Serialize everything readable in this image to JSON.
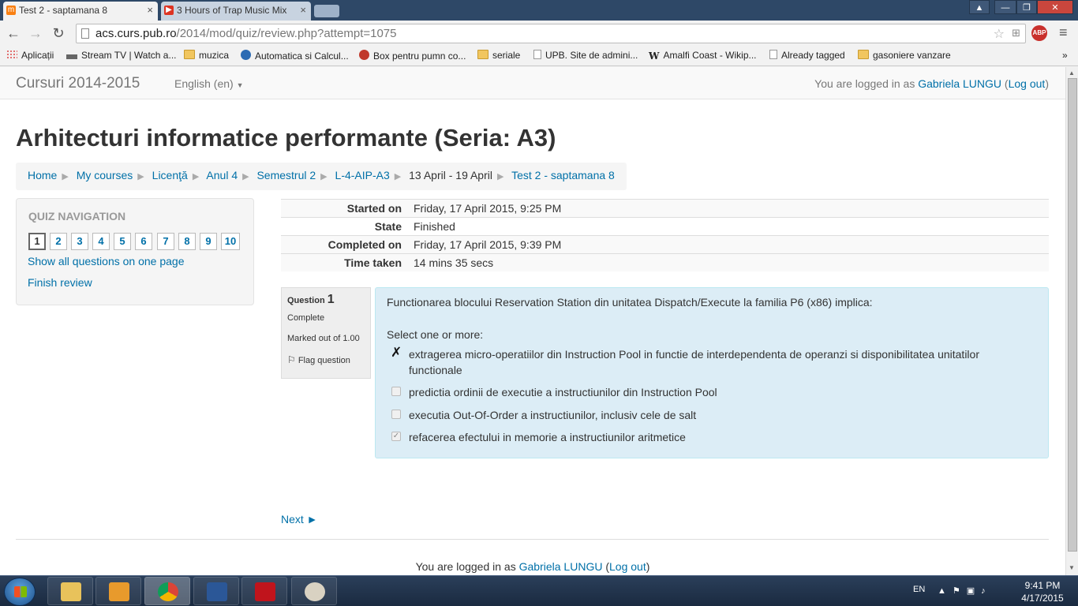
{
  "browser": {
    "tabs": [
      {
        "title": "Test 2 - saptamana 8",
        "active": true
      },
      {
        "title": "3 Hours of Trap Music Mix",
        "active": false
      }
    ],
    "tab_close": "×",
    "url_host": "acs.curs.pub.ro",
    "url_path": "/2014/mod/quiz/review.php?attempt=1075",
    "abp_label": "ABP",
    "bookmarks": [
      {
        "label": "Aplicații",
        "icon": "apps-grid-icon"
      },
      {
        "label": "Stream TV | Watch a...",
        "icon": "tv-icon"
      },
      {
        "label": "muzica",
        "icon": "folder-icon"
      },
      {
        "label": "Automatica si Calcul...",
        "icon": "site-icon"
      },
      {
        "label": "Box pentru pumn co...",
        "icon": "gear-icon"
      },
      {
        "label": "seriale",
        "icon": "folder-icon"
      },
      {
        "label": "UPB. Site de admini...",
        "icon": "page-icon"
      },
      {
        "label": "Amalfi Coast - Wikip...",
        "icon": "wikipedia-icon"
      },
      {
        "label": "Already tagged",
        "icon": "page-icon"
      },
      {
        "label": "gasoniere vanzare",
        "icon": "folder-icon"
      }
    ],
    "bookmarks_overflow": "»"
  },
  "site": {
    "brand": "Cursuri 2014-2015",
    "language": "English (en)",
    "login_prefix": "You are logged in as",
    "user": "Gabriela LUNGU",
    "logout": "Log out"
  },
  "course_title": "Arhitecturi informatice performante (Seria: A3)",
  "breadcrumb": [
    {
      "label": "Home",
      "link": true
    },
    {
      "label": "My courses",
      "link": true
    },
    {
      "label": "Licenţă",
      "link": true
    },
    {
      "label": "Anul 4",
      "link": true
    },
    {
      "label": "Semestrul 2",
      "link": true
    },
    {
      "label": "L-4-AIP-A3",
      "link": true
    },
    {
      "label": "13 April - 19 April",
      "link": false
    },
    {
      "label": "Test 2 - saptamana 8",
      "link": true
    }
  ],
  "quiz_nav": {
    "title": "QUIZ NAVIGATION",
    "buttons": [
      "1",
      "2",
      "3",
      "4",
      "5",
      "6",
      "7",
      "8",
      "9",
      "10"
    ],
    "current": "1",
    "show_all": "Show all questions on one page",
    "finish": "Finish review"
  },
  "summary": [
    {
      "label": "Started on",
      "value": "Friday, 17 April 2015, 9:25 PM"
    },
    {
      "label": "State",
      "value": "Finished"
    },
    {
      "label": "Completed on",
      "value": "Friday, 17 April 2015, 9:39 PM"
    },
    {
      "label": "Time taken",
      "value": "14 mins 35 secs"
    }
  ],
  "question": {
    "label": "Question",
    "number": "1",
    "state": "Complete",
    "grade": "Marked out of 1.00",
    "flag": "Flag question",
    "text": "Functionarea blocului Reservation Station din unitatea Dispatch/Execute la familia P6 (x86) implica:",
    "prompt": "Select one or more:",
    "answers": [
      {
        "text": "extragerea micro-operatiilor din Instruction Pool in functie de interdependenta de operanzi si disponibilitatea unitatilor functionale",
        "checked": true,
        "mark": "wrong"
      },
      {
        "text": "predictia ordinii de executie a instructiunilor din Instruction Pool",
        "checked": false
      },
      {
        "text": "executia Out-Of-Order a instructiunilor, inclusiv cele de salt",
        "checked": false
      },
      {
        "text": "refacerea efectului in memorie a instructiunilor aritmetice",
        "checked": true
      }
    ]
  },
  "next_label": "Next ►",
  "taskbar": {
    "apps": [
      "file-explorer",
      "media-player",
      "chrome",
      "word",
      "acrobat",
      "paint"
    ],
    "language": "EN",
    "time": "9:41 PM",
    "date": "4/17/2015"
  },
  "colors": {
    "link": "#0070a8",
    "question_bg": "#dcedf6",
    "taskbar": "#1a2a40"
  }
}
